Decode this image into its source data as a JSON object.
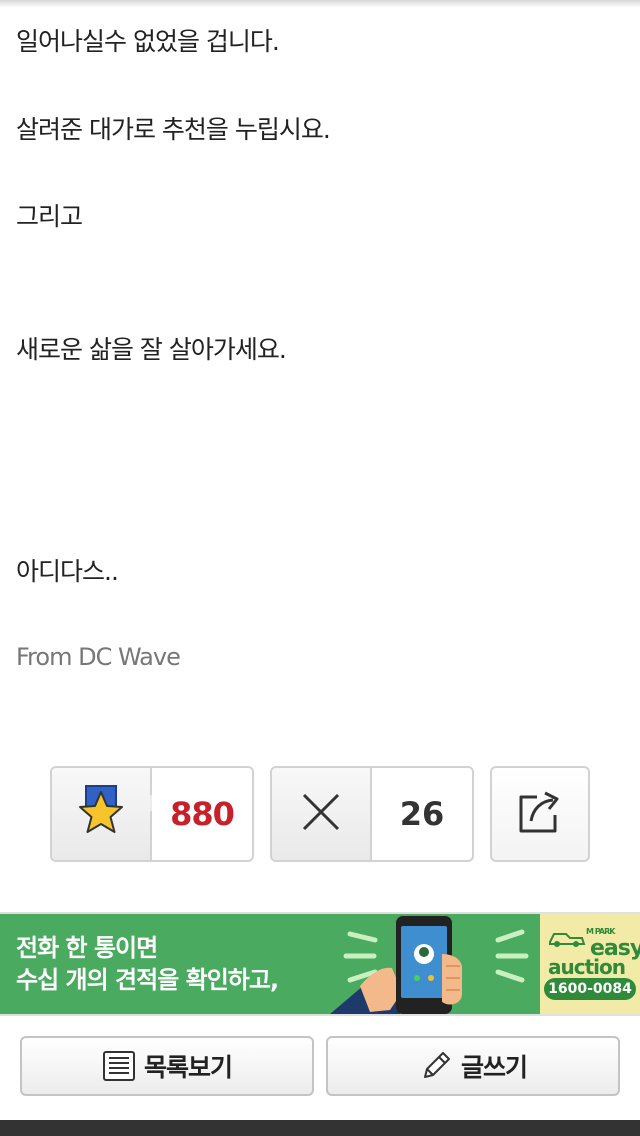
{
  "post": {
    "lines": [
      "일어나실수 없었을 겁니다.",
      "살려준 대가로 추천을 누립시요.",
      "그리고",
      "새로운 삶을 잘 살아가세요.",
      "아디다스.."
    ],
    "from": "From DC Wave"
  },
  "actions": {
    "recommend_count": "880",
    "nonrecommend_count": "26"
  },
  "ad": {
    "line1": "전화 한 통이면",
    "line2": "수십 개의 견적을 확인하고,",
    "brand_small": "M PARK",
    "brand_easy": "easy",
    "brand_auction": "auction",
    "phone": "1600-0084"
  },
  "bottom": {
    "list_label": "목록보기",
    "write_label": "글쓰기"
  },
  "colors": {
    "recommend_count": "#c8202a",
    "ad_green": "#4aaa5f",
    "ad_logo_bg": "#f2eba7"
  }
}
